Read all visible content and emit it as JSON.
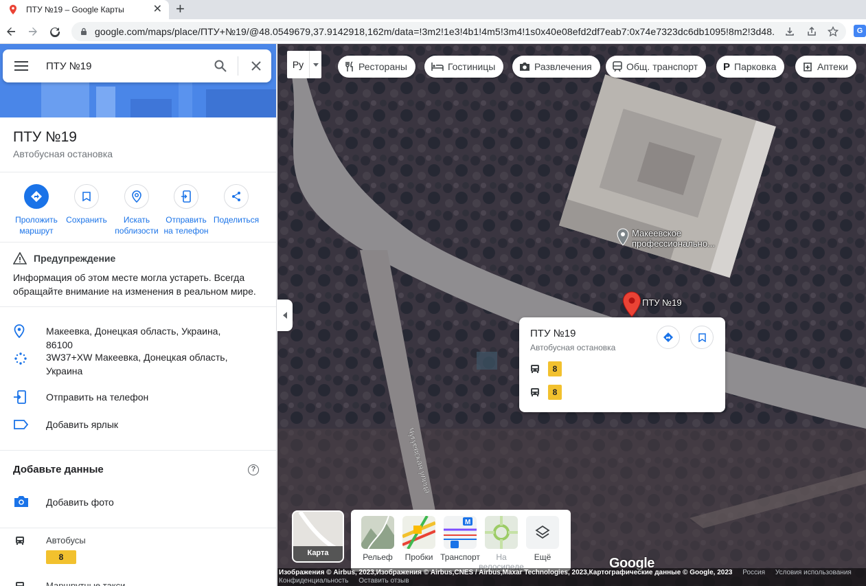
{
  "browser": {
    "tab_title": "ПТУ №19 – Google Карты",
    "new_tab": "+",
    "url": "google.com/maps/place/ПТУ+№19/@48.0549679,37.9142918,162m/data=!3m2!1e3!4b1!4m5!3m4!1s0x40e08efd2df7eab7:0x74e7323dc6db1095!8m2!3d48.05..."
  },
  "search": {
    "query": "ПТУ №19"
  },
  "place": {
    "title": "ПТУ №19",
    "type": "Автобусная остановка",
    "actions": [
      {
        "label": "Проложить маршрут"
      },
      {
        "label": "Сохранить"
      },
      {
        "label": "Искать поблизости"
      },
      {
        "label": "Отправить на телефон"
      },
      {
        "label": "Поделиться"
      }
    ],
    "warning_title": "Предупреждение",
    "warning_text": "Информация об этом месте могла устареть. Всегда обращайте внимание на изменения в реальном мире.",
    "address": "Макеевка, Донецкая область, Украина, 86100",
    "plus_code": "3W37+XW Макеевка, Донецкая область, Украина",
    "send_to_phone": "Отправить на телефон",
    "add_label": "Добавить ярлык",
    "add_data_title": "Добавьте данные",
    "add_photo": "Добавить фото",
    "buses_label": "Автобусы",
    "bus_route": "8",
    "taxi_label": "Маршрутные такси"
  },
  "map": {
    "lang_toggle": "Ру",
    "chips": [
      "Рестораны",
      "Гостиницы",
      "Развлечения",
      "Общ. транспорт",
      "Парковка",
      "Аптеки"
    ],
    "poi_label": "Макеевское профессионально...",
    "pin_label": "ПТУ №19",
    "street_label": "Чугуевская улица",
    "card": {
      "title": "ПТУ №19",
      "subtitle": "Автобусная остановка",
      "routes": [
        "8",
        "8"
      ]
    },
    "map_thumb_label": "Карта",
    "layers": [
      {
        "label": "Рельеф"
      },
      {
        "label": "Пробки"
      },
      {
        "label": "Транспорт"
      },
      {
        "label": "На велосипеде"
      },
      {
        "label": "Ещё"
      }
    ],
    "google_logo": "Google",
    "attribution": "Изображения © Airbus, 2023,Изображения © Airbus,CNES / Airbus,Maxar Technologies, 2023,Картографические данные © Google, 2023",
    "footer_links": [
      "Россия",
      "Условия использования",
      "Конфиденциальность",
      "Оставить отзыв"
    ]
  },
  "colors": {
    "accent": "#1a73e8",
    "badge": "#f2c12e",
    "pin": "#ea4335"
  }
}
